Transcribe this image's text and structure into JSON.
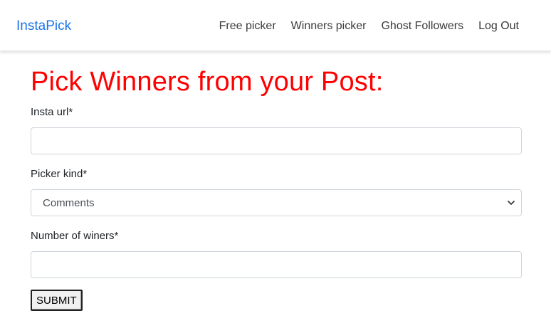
{
  "navbar": {
    "brand": "InstaPick",
    "links": [
      {
        "label": "Free picker"
      },
      {
        "label": "Winners picker"
      },
      {
        "label": "Ghost Followers"
      },
      {
        "label": "Log Out"
      }
    ]
  },
  "form": {
    "title": "Pick Winners from your Post:",
    "insta_url": {
      "label": "Insta url*",
      "value": "",
      "placeholder": ""
    },
    "picker_kind": {
      "label": "Picker kind*",
      "selected": "Comments"
    },
    "number_of_winners": {
      "label": "Number of winers*",
      "value": "",
      "placeholder": ""
    },
    "submit_label": "SUBMIT"
  },
  "colors": {
    "brand": "#1a73e8",
    "title": "#ff0000"
  },
  "icons": {
    "select_arrow": "chevron-down-icon"
  }
}
